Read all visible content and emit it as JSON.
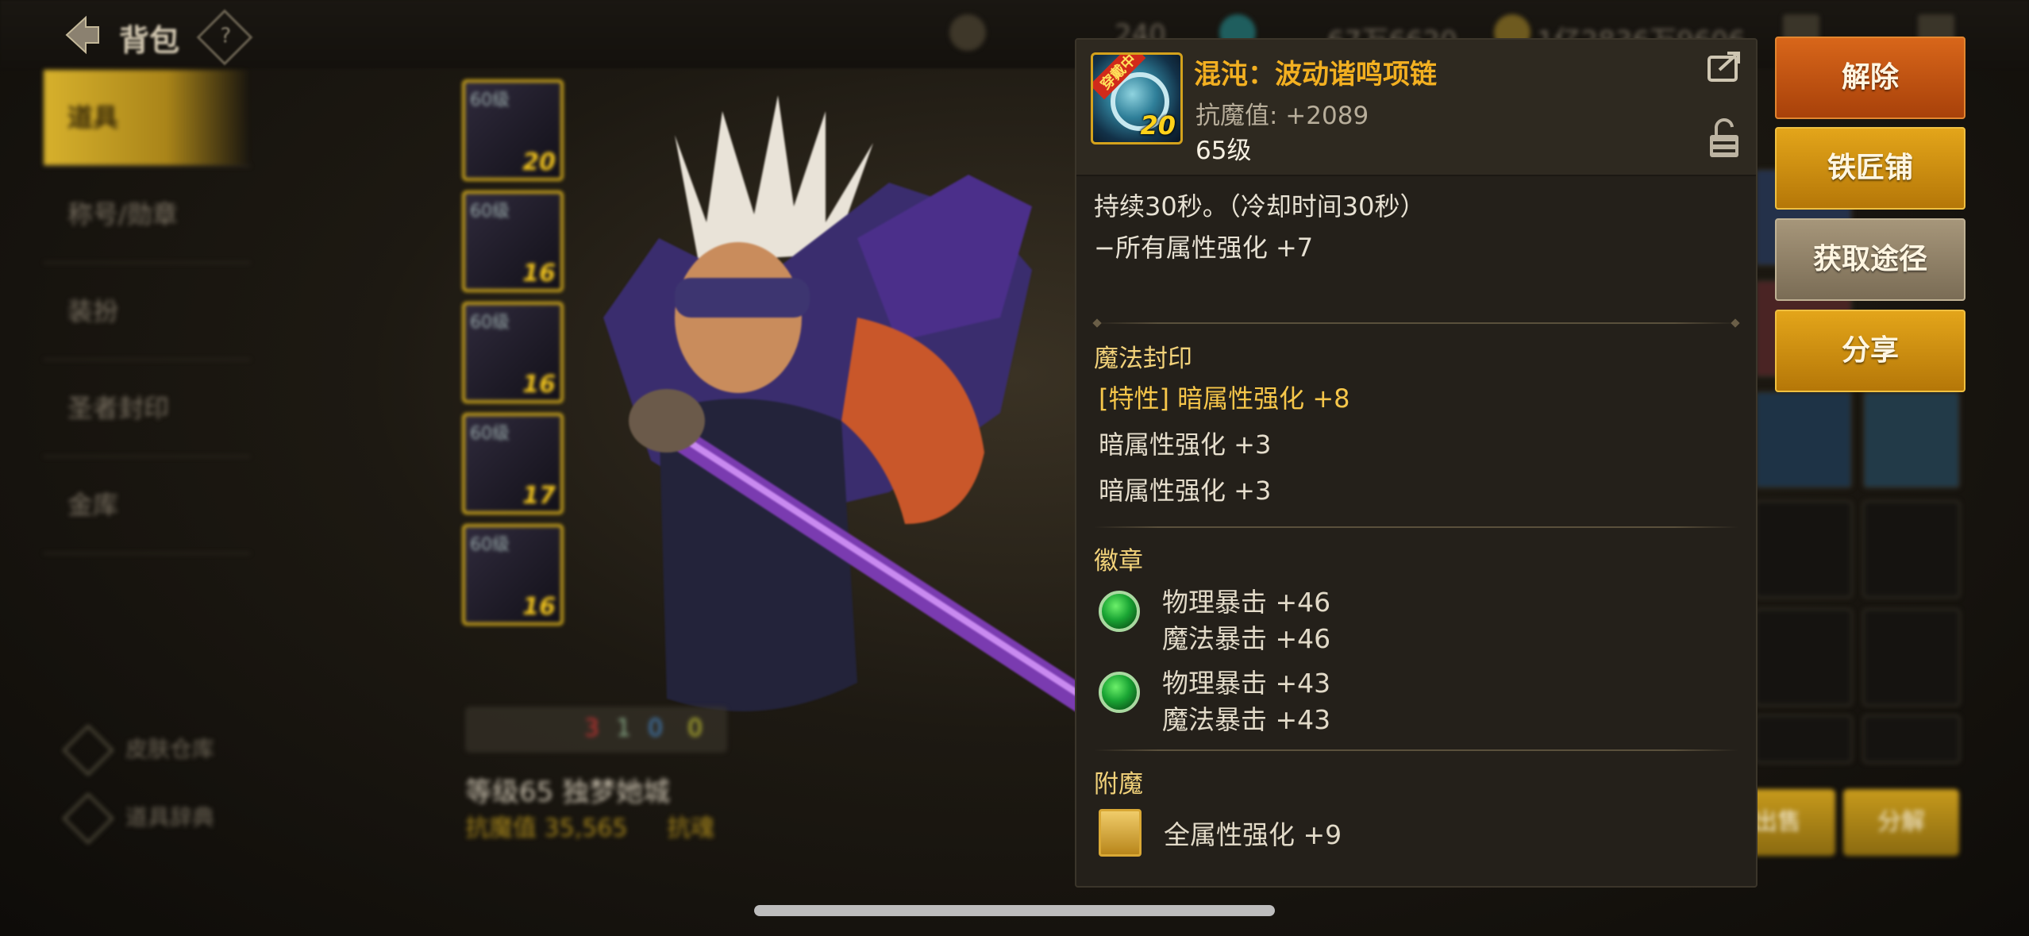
{
  "topbar": {
    "title": "背包",
    "help_symbol": "?",
    "stat_fatigue": "240",
    "stat_gold": "67万6620",
    "stat_points": "1亿2836万9606"
  },
  "sidebar": {
    "items": [
      {
        "label": "道具"
      },
      {
        "label": "称号/勋章"
      },
      {
        "label": "装扮"
      },
      {
        "label": "圣者封印"
      },
      {
        "label": "金库"
      }
    ],
    "links": [
      {
        "label": "皮肤仓库"
      },
      {
        "label": "道具辞典"
      }
    ]
  },
  "equip_slots": [
    {
      "level": "60级",
      "plus": "20"
    },
    {
      "level": "60级",
      "plus": "16"
    },
    {
      "level": "60级",
      "plus": "16"
    },
    {
      "level": "60级",
      "plus": "17"
    },
    {
      "level": "60级",
      "plus": "16"
    }
  ],
  "character": {
    "counts": [
      "3",
      "1",
      "0",
      "0"
    ],
    "name_line": "等级65 独梦她城",
    "power_line": "抗魔值 35,565",
    "power_extra": "抗魂"
  },
  "bg_buttons": {
    "sell": "出售",
    "disassemble": "分解"
  },
  "tooltip": {
    "icon_badge": "穿戴中",
    "icon_plus": "20",
    "name": "混沌：波动谐鸣项链",
    "resist": "抗魔值: +2089",
    "level": "65级",
    "desc": [
      "持续30秒。（冷却时间30秒）",
      "−所有属性强化 +7"
    ],
    "seal_title": "魔法封印",
    "seal_lines": [
      {
        "text": "[特性] 暗属性强化 +8",
        "special": true
      },
      {
        "text": "暗属性强化 +3",
        "special": false
      },
      {
        "text": "暗属性强化 +3",
        "special": false
      }
    ],
    "emblem_title": "徽章",
    "emblems": [
      {
        "line1": "物理暴击 +46",
        "line2": "魔法暴击 +46"
      },
      {
        "line1": "物理暴击 +43",
        "line2": "魔法暴击 +43"
      }
    ],
    "enchant_title": "附魔",
    "enchant": "全属性强化 +9"
  },
  "actions": {
    "remove": "解除",
    "blacksmith": "铁匠铺",
    "source": "获取途径",
    "share": "分享"
  },
  "colors": {
    "item_name": "#f3b021",
    "action_remove": "#c4561a",
    "action_gold": "#d18f12",
    "action_source": "#8f826a"
  }
}
